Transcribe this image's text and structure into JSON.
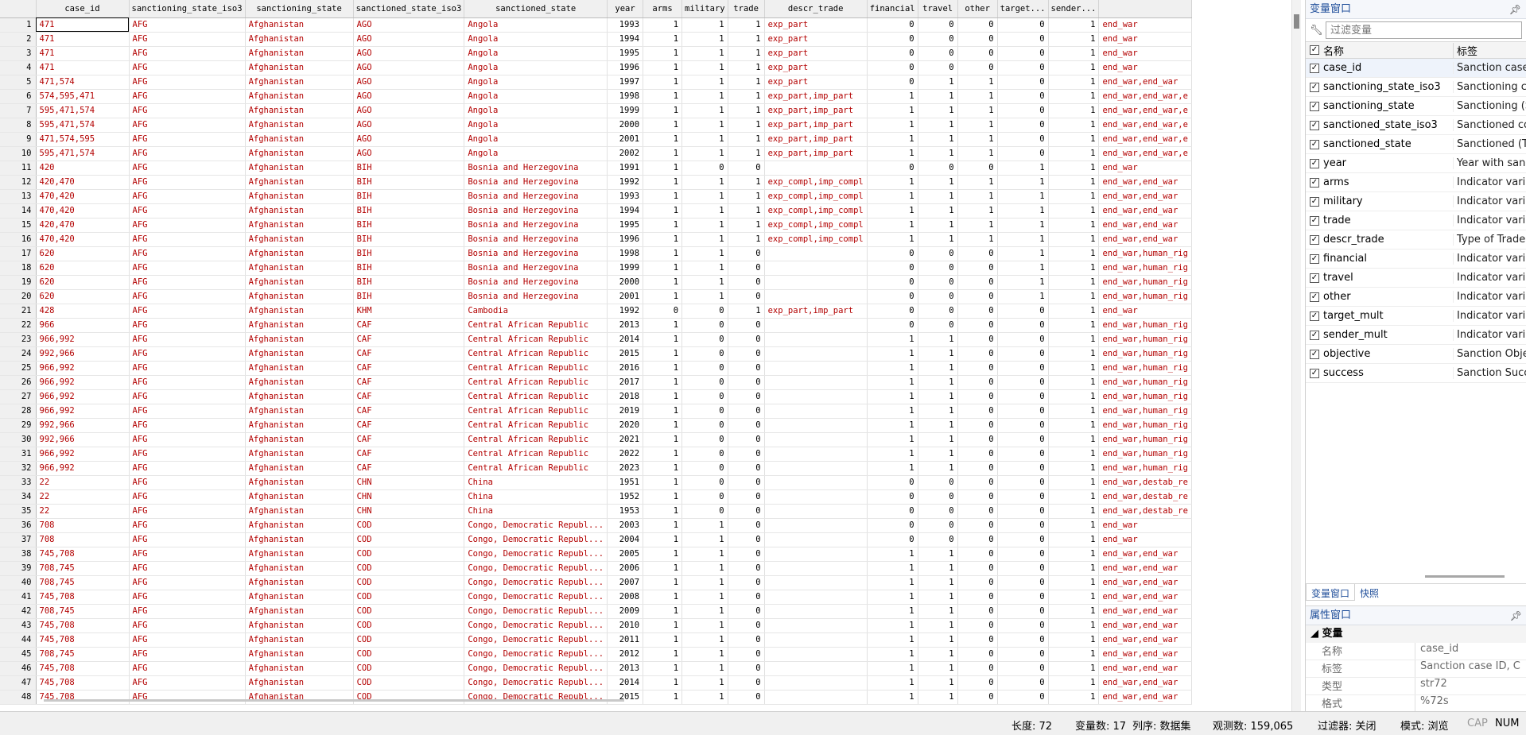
{
  "grid": {
    "columns": [
      "case_id",
      "sanctioning_state_iso3",
      "sanctioning_state",
      "sanctioned_state_iso3",
      "sanctioned_state",
      "year",
      "arms",
      "military",
      "trade",
      "descr_trade",
      "financial",
      "travel",
      "other",
      "target...",
      "sender...",
      ""
    ],
    "rows": [
      [
        "1",
        "471",
        "AFG",
        "Afghanistan",
        "AGO",
        "Angola",
        "1993",
        "1",
        "1",
        "1",
        "exp_part",
        "0",
        "0",
        "0",
        "0",
        "1",
        "end_war"
      ],
      [
        "2",
        "471",
        "AFG",
        "Afghanistan",
        "AGO",
        "Angola",
        "1994",
        "1",
        "1",
        "1",
        "exp_part",
        "0",
        "0",
        "0",
        "0",
        "1",
        "end_war"
      ],
      [
        "3",
        "471",
        "AFG",
        "Afghanistan",
        "AGO",
        "Angola",
        "1995",
        "1",
        "1",
        "1",
        "exp_part",
        "0",
        "0",
        "0",
        "0",
        "1",
        "end_war"
      ],
      [
        "4",
        "471",
        "AFG",
        "Afghanistan",
        "AGO",
        "Angola",
        "1996",
        "1",
        "1",
        "1",
        "exp_part",
        "0",
        "0",
        "0",
        "0",
        "1",
        "end_war"
      ],
      [
        "5",
        "471,574",
        "AFG",
        "Afghanistan",
        "AGO",
        "Angola",
        "1997",
        "1",
        "1",
        "1",
        "exp_part",
        "0",
        "1",
        "1",
        "0",
        "1",
        "end_war,end_war"
      ],
      [
        "6",
        "574,595,471",
        "AFG",
        "Afghanistan",
        "AGO",
        "Angola",
        "1998",
        "1",
        "1",
        "1",
        "exp_part,imp_part",
        "1",
        "1",
        "1",
        "0",
        "1",
        "end_war,end_war,e"
      ],
      [
        "7",
        "595,471,574",
        "AFG",
        "Afghanistan",
        "AGO",
        "Angola",
        "1999",
        "1",
        "1",
        "1",
        "exp_part,imp_part",
        "1",
        "1",
        "1",
        "0",
        "1",
        "end_war,end_war,e"
      ],
      [
        "8",
        "595,471,574",
        "AFG",
        "Afghanistan",
        "AGO",
        "Angola",
        "2000",
        "1",
        "1",
        "1",
        "exp_part,imp_part",
        "1",
        "1",
        "1",
        "0",
        "1",
        "end_war,end_war,e"
      ],
      [
        "9",
        "471,574,595",
        "AFG",
        "Afghanistan",
        "AGO",
        "Angola",
        "2001",
        "1",
        "1",
        "1",
        "exp_part,imp_part",
        "1",
        "1",
        "1",
        "0",
        "1",
        "end_war,end_war,e"
      ],
      [
        "10",
        "595,471,574",
        "AFG",
        "Afghanistan",
        "AGO",
        "Angola",
        "2002",
        "1",
        "1",
        "1",
        "exp_part,imp_part",
        "1",
        "1",
        "1",
        "0",
        "1",
        "end_war,end_war,e"
      ],
      [
        "11",
        "420",
        "AFG",
        "Afghanistan",
        "BIH",
        "Bosnia and Herzegovina",
        "1991",
        "1",
        "0",
        "0",
        "",
        "0",
        "0",
        "0",
        "1",
        "1",
        "end_war"
      ],
      [
        "12",
        "420,470",
        "AFG",
        "Afghanistan",
        "BIH",
        "Bosnia and Herzegovina",
        "1992",
        "1",
        "1",
        "1",
        "exp_compl,imp_compl",
        "1",
        "1",
        "1",
        "1",
        "1",
        "end_war,end_war"
      ],
      [
        "13",
        "470,420",
        "AFG",
        "Afghanistan",
        "BIH",
        "Bosnia and Herzegovina",
        "1993",
        "1",
        "1",
        "1",
        "exp_compl,imp_compl",
        "1",
        "1",
        "1",
        "1",
        "1",
        "end_war,end_war"
      ],
      [
        "14",
        "470,420",
        "AFG",
        "Afghanistan",
        "BIH",
        "Bosnia and Herzegovina",
        "1994",
        "1",
        "1",
        "1",
        "exp_compl,imp_compl",
        "1",
        "1",
        "1",
        "1",
        "1",
        "end_war,end_war"
      ],
      [
        "15",
        "420,470",
        "AFG",
        "Afghanistan",
        "BIH",
        "Bosnia and Herzegovina",
        "1995",
        "1",
        "1",
        "1",
        "exp_compl,imp_compl",
        "1",
        "1",
        "1",
        "1",
        "1",
        "end_war,end_war"
      ],
      [
        "16",
        "470,420",
        "AFG",
        "Afghanistan",
        "BIH",
        "Bosnia and Herzegovina",
        "1996",
        "1",
        "1",
        "1",
        "exp_compl,imp_compl",
        "1",
        "1",
        "1",
        "1",
        "1",
        "end_war,end_war"
      ],
      [
        "17",
        "620",
        "AFG",
        "Afghanistan",
        "BIH",
        "Bosnia and Herzegovina",
        "1998",
        "1",
        "1",
        "0",
        "",
        "0",
        "0",
        "0",
        "1",
        "1",
        "end_war,human_rig"
      ],
      [
        "18",
        "620",
        "AFG",
        "Afghanistan",
        "BIH",
        "Bosnia and Herzegovina",
        "1999",
        "1",
        "1",
        "0",
        "",
        "0",
        "0",
        "0",
        "1",
        "1",
        "end_war,human_rig"
      ],
      [
        "19",
        "620",
        "AFG",
        "Afghanistan",
        "BIH",
        "Bosnia and Herzegovina",
        "2000",
        "1",
        "1",
        "0",
        "",
        "0",
        "0",
        "0",
        "1",
        "1",
        "end_war,human_rig"
      ],
      [
        "20",
        "620",
        "AFG",
        "Afghanistan",
        "BIH",
        "Bosnia and Herzegovina",
        "2001",
        "1",
        "1",
        "0",
        "",
        "0",
        "0",
        "0",
        "1",
        "1",
        "end_war,human_rig"
      ],
      [
        "21",
        "428",
        "AFG",
        "Afghanistan",
        "KHM",
        "Cambodia",
        "1992",
        "0",
        "0",
        "1",
        "exp_part,imp_part",
        "0",
        "0",
        "0",
        "0",
        "1",
        "end_war"
      ],
      [
        "22",
        "966",
        "AFG",
        "Afghanistan",
        "CAF",
        "Central African Republic",
        "2013",
        "1",
        "0",
        "0",
        "",
        "0",
        "0",
        "0",
        "0",
        "1",
        "end_war,human_rig"
      ],
      [
        "23",
        "966,992",
        "AFG",
        "Afghanistan",
        "CAF",
        "Central African Republic",
        "2014",
        "1",
        "0",
        "0",
        "",
        "1",
        "1",
        "0",
        "0",
        "1",
        "end_war,human_rig"
      ],
      [
        "24",
        "992,966",
        "AFG",
        "Afghanistan",
        "CAF",
        "Central African Republic",
        "2015",
        "1",
        "0",
        "0",
        "",
        "1",
        "1",
        "0",
        "0",
        "1",
        "end_war,human_rig"
      ],
      [
        "25",
        "966,992",
        "AFG",
        "Afghanistan",
        "CAF",
        "Central African Republic",
        "2016",
        "1",
        "0",
        "0",
        "",
        "1",
        "1",
        "0",
        "0",
        "1",
        "end_war,human_rig"
      ],
      [
        "26",
        "966,992",
        "AFG",
        "Afghanistan",
        "CAF",
        "Central African Republic",
        "2017",
        "1",
        "0",
        "0",
        "",
        "1",
        "1",
        "0",
        "0",
        "1",
        "end_war,human_rig"
      ],
      [
        "27",
        "966,992",
        "AFG",
        "Afghanistan",
        "CAF",
        "Central African Republic",
        "2018",
        "1",
        "0",
        "0",
        "",
        "1",
        "1",
        "0",
        "0",
        "1",
        "end_war,human_rig"
      ],
      [
        "28",
        "966,992",
        "AFG",
        "Afghanistan",
        "CAF",
        "Central African Republic",
        "2019",
        "1",
        "0",
        "0",
        "",
        "1",
        "1",
        "0",
        "0",
        "1",
        "end_war,human_rig"
      ],
      [
        "29",
        "992,966",
        "AFG",
        "Afghanistan",
        "CAF",
        "Central African Republic",
        "2020",
        "1",
        "0",
        "0",
        "",
        "1",
        "1",
        "0",
        "0",
        "1",
        "end_war,human_rig"
      ],
      [
        "30",
        "992,966",
        "AFG",
        "Afghanistan",
        "CAF",
        "Central African Republic",
        "2021",
        "1",
        "0",
        "0",
        "",
        "1",
        "1",
        "0",
        "0",
        "1",
        "end_war,human_rig"
      ],
      [
        "31",
        "966,992",
        "AFG",
        "Afghanistan",
        "CAF",
        "Central African Republic",
        "2022",
        "1",
        "0",
        "0",
        "",
        "1",
        "1",
        "0",
        "0",
        "1",
        "end_war,human_rig"
      ],
      [
        "32",
        "966,992",
        "AFG",
        "Afghanistan",
        "CAF",
        "Central African Republic",
        "2023",
        "1",
        "0",
        "0",
        "",
        "1",
        "1",
        "0",
        "0",
        "1",
        "end_war,human_rig"
      ],
      [
        "33",
        "22",
        "AFG",
        "Afghanistan",
        "CHN",
        "China",
        "1951",
        "1",
        "0",
        "0",
        "",
        "0",
        "0",
        "0",
        "0",
        "1",
        "end_war,destab_re"
      ],
      [
        "34",
        "22",
        "AFG",
        "Afghanistan",
        "CHN",
        "China",
        "1952",
        "1",
        "0",
        "0",
        "",
        "0",
        "0",
        "0",
        "0",
        "1",
        "end_war,destab_re"
      ],
      [
        "35",
        "22",
        "AFG",
        "Afghanistan",
        "CHN",
        "China",
        "1953",
        "1",
        "0",
        "0",
        "",
        "0",
        "0",
        "0",
        "0",
        "1",
        "end_war,destab_re"
      ],
      [
        "36",
        "708",
        "AFG",
        "Afghanistan",
        "COD",
        "Congo, Democratic Republ...",
        "2003",
        "1",
        "1",
        "0",
        "",
        "0",
        "0",
        "0",
        "0",
        "1",
        "end_war"
      ],
      [
        "37",
        "708",
        "AFG",
        "Afghanistan",
        "COD",
        "Congo, Democratic Republ...",
        "2004",
        "1",
        "1",
        "0",
        "",
        "0",
        "0",
        "0",
        "0",
        "1",
        "end_war"
      ],
      [
        "38",
        "745,708",
        "AFG",
        "Afghanistan",
        "COD",
        "Congo, Democratic Republ...",
        "2005",
        "1",
        "1",
        "0",
        "",
        "1",
        "1",
        "0",
        "0",
        "1",
        "end_war,end_war"
      ],
      [
        "39",
        "708,745",
        "AFG",
        "Afghanistan",
        "COD",
        "Congo, Democratic Republ...",
        "2006",
        "1",
        "1",
        "0",
        "",
        "1",
        "1",
        "0",
        "0",
        "1",
        "end_war,end_war"
      ],
      [
        "40",
        "708,745",
        "AFG",
        "Afghanistan",
        "COD",
        "Congo, Democratic Republ...",
        "2007",
        "1",
        "1",
        "0",
        "",
        "1",
        "1",
        "0",
        "0",
        "1",
        "end_war,end_war"
      ],
      [
        "41",
        "745,708",
        "AFG",
        "Afghanistan",
        "COD",
        "Congo, Democratic Republ...",
        "2008",
        "1",
        "1",
        "0",
        "",
        "1",
        "1",
        "0",
        "0",
        "1",
        "end_war,end_war"
      ],
      [
        "42",
        "708,745",
        "AFG",
        "Afghanistan",
        "COD",
        "Congo, Democratic Republ...",
        "2009",
        "1",
        "1",
        "0",
        "",
        "1",
        "1",
        "0",
        "0",
        "1",
        "end_war,end_war"
      ],
      [
        "43",
        "745,708",
        "AFG",
        "Afghanistan",
        "COD",
        "Congo, Democratic Republ...",
        "2010",
        "1",
        "1",
        "0",
        "",
        "1",
        "1",
        "0",
        "0",
        "1",
        "end_war,end_war"
      ],
      [
        "44",
        "745,708",
        "AFG",
        "Afghanistan",
        "COD",
        "Congo, Democratic Republ...",
        "2011",
        "1",
        "1",
        "0",
        "",
        "1",
        "1",
        "0",
        "0",
        "1",
        "end_war,end_war"
      ],
      [
        "45",
        "708,745",
        "AFG",
        "Afghanistan",
        "COD",
        "Congo, Democratic Republ...",
        "2012",
        "1",
        "1",
        "0",
        "",
        "1",
        "1",
        "0",
        "0",
        "1",
        "end_war,end_war"
      ],
      [
        "46",
        "745,708",
        "AFG",
        "Afghanistan",
        "COD",
        "Congo, Democratic Republ...",
        "2013",
        "1",
        "1",
        "0",
        "",
        "1",
        "1",
        "0",
        "0",
        "1",
        "end_war,end_war"
      ],
      [
        "47",
        "745,708",
        "AFG",
        "Afghanistan",
        "COD",
        "Congo, Democratic Republ...",
        "2014",
        "1",
        "1",
        "0",
        "",
        "1",
        "1",
        "0",
        "0",
        "1",
        "end_war,end_war"
      ],
      [
        "48",
        "745,708",
        "AFG",
        "Afghanistan",
        "COD",
        "Congo, Democratic Republ...",
        "2015",
        "1",
        "1",
        "0",
        "",
        "1",
        "1",
        "0",
        "0",
        "1",
        "end_war,end_war"
      ]
    ]
  },
  "variables_window": {
    "title": "变量窗口",
    "filter_placeholder": "过滤变量",
    "header_name": "名称",
    "header_label": "标签",
    "items": [
      {
        "name": "case_id",
        "label": "Sanction case ID, C"
      },
      {
        "name": "sanctioning_state_iso3",
        "label": "Sanctioning country"
      },
      {
        "name": "sanctioning_state",
        "label": "Sanctioning (Sende"
      },
      {
        "name": "sanctioned_state_iso3",
        "label": "Sanctioned country"
      },
      {
        "name": "sanctioned_state",
        "label": "Sanctioned (Target)"
      },
      {
        "name": "year",
        "label": "Year with sanction"
      },
      {
        "name": "arms",
        "label": "Indicator variable"
      },
      {
        "name": "military",
        "label": "Indicator variable"
      },
      {
        "name": "trade",
        "label": "Indicator variable"
      },
      {
        "name": "descr_trade",
        "label": "Type of Trade sanc"
      },
      {
        "name": "financial",
        "label": "Indicator variable"
      },
      {
        "name": "travel",
        "label": "Indicator variable"
      },
      {
        "name": "other",
        "label": "Indicator variable"
      },
      {
        "name": "target_mult",
        "label": "Indicator variable"
      },
      {
        "name": "sender_mult",
        "label": "Indicator variable"
      },
      {
        "name": "objective",
        "label": "Sanction Objective"
      },
      {
        "name": "success",
        "label": "Sanction Success"
      }
    ],
    "tabs": [
      "变量窗口",
      "快照"
    ]
  },
  "properties_window": {
    "title": "属性窗口",
    "group": "变量",
    "rows": [
      {
        "key": "名称",
        "value": "case_id"
      },
      {
        "key": "标签",
        "value": "Sanction case ID, C"
      },
      {
        "key": "类型",
        "value": "str72"
      },
      {
        "key": "格式",
        "value": "%72s"
      }
    ]
  },
  "status_bar": {
    "length": "长度: 72",
    "vars": "变量数: 17",
    "order": "列序: 数据集",
    "obs": "观测数: 159,065",
    "filter": "过滤器: 关闭",
    "mode": "模式: 浏览",
    "cap": "CAP",
    "num": "NUM"
  },
  "colors": {
    "string_text": "#b30000",
    "numeric_text": "#000000",
    "header_bg": "#f0f0f0",
    "panel_title": "#1f4e9a"
  },
  "icons": {
    "pin": "pin-icon",
    "filter": "wrench-icon",
    "checkbox": "checkbox-checked-icon",
    "collapse": "triangle-down-icon"
  }
}
